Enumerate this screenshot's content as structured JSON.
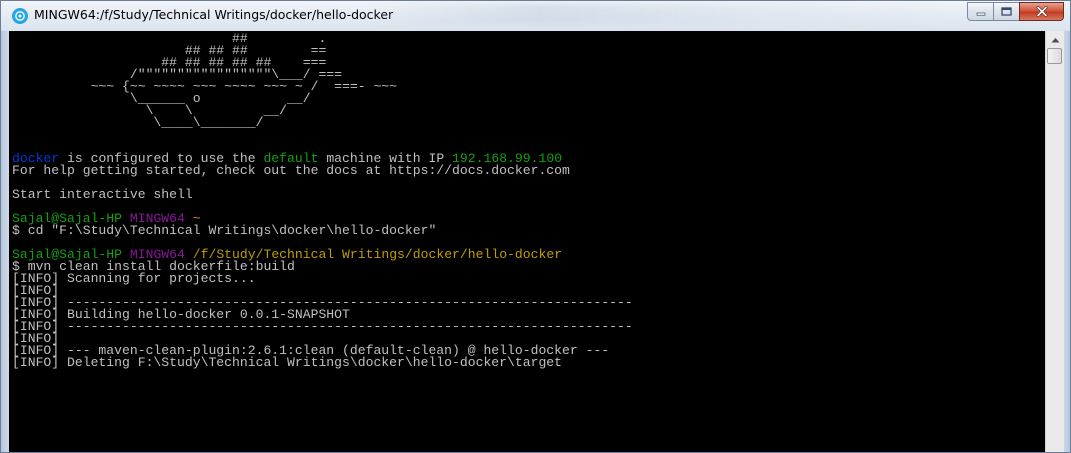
{
  "window": {
    "title": "MINGW64:/f/Study/Technical Writings/docker/hello-docker",
    "icon": "git-bash-icon",
    "controls": {
      "minimize_icon": "minimize-icon",
      "maximize_icon": "maximize-icon",
      "close_icon": "close-icon"
    }
  },
  "colors": {
    "background": "#000000",
    "text": "#c0c0c0",
    "blue": "#0037da",
    "green": "#13a10e",
    "magenta": "#881798",
    "yellow": "#c19c00"
  },
  "terminal": {
    "lines": [
      {
        "segments": [
          {
            "text": "                            ##         .",
            "color": "white"
          }
        ]
      },
      {
        "segments": [
          {
            "text": "                      ## ## ##        ==",
            "color": "white"
          }
        ]
      },
      {
        "segments": [
          {
            "text": "                   ## ## ## ## ##    ===",
            "color": "white"
          }
        ]
      },
      {
        "segments": [
          {
            "text": "               /\"\"\"\"\"\"\"\"\"\"\"\"\"\"\"\"\"\\___/ ===",
            "color": "white"
          }
        ]
      },
      {
        "segments": [
          {
            "text": "          ~~~ {~~ ~~~~ ~~~ ~~~~ ~~~ ~ /  ===- ~~~",
            "color": "white"
          }
        ]
      },
      {
        "segments": [
          {
            "text": "               \\______ o           __/",
            "color": "white"
          }
        ]
      },
      {
        "segments": [
          {
            "text": "                 \\    \\         __/",
            "color": "white"
          }
        ]
      },
      {
        "segments": [
          {
            "text": "                  \\____\\_______/",
            "color": "white"
          }
        ]
      },
      {
        "segments": [
          {
            "text": "",
            "color": "white"
          }
        ]
      },
      {
        "segments": [
          {
            "text": "",
            "color": "white"
          }
        ]
      },
      {
        "segments": [
          {
            "text": "docker",
            "color": "blue"
          },
          {
            "text": " is configured to use the ",
            "color": "white"
          },
          {
            "text": "default",
            "color": "green"
          },
          {
            "text": " machine with IP ",
            "color": "white"
          },
          {
            "text": "192.168.99.100",
            "color": "green"
          }
        ]
      },
      {
        "segments": [
          {
            "text": "For help getting started, check out the docs at https://docs.docker.com",
            "color": "white"
          }
        ]
      },
      {
        "segments": [
          {
            "text": "",
            "color": "white"
          }
        ]
      },
      {
        "segments": [
          {
            "text": "Start interactive shell",
            "color": "white"
          }
        ]
      },
      {
        "segments": [
          {
            "text": "",
            "color": "white"
          }
        ]
      },
      {
        "segments": [
          {
            "text": "Sajal@Sajal-HP",
            "color": "green"
          },
          {
            "text": " ",
            "color": "white"
          },
          {
            "text": "MINGW64",
            "color": "magenta"
          },
          {
            "text": " ",
            "color": "white"
          },
          {
            "text": "~",
            "color": "yellow"
          }
        ]
      },
      {
        "segments": [
          {
            "text": "$ cd \"F:\\Study\\Technical Writings\\docker\\hello-docker\"",
            "color": "white"
          }
        ]
      },
      {
        "segments": [
          {
            "text": "",
            "color": "white"
          }
        ]
      },
      {
        "segments": [
          {
            "text": "Sajal@Sajal-HP",
            "color": "green"
          },
          {
            "text": " ",
            "color": "white"
          },
          {
            "text": "MINGW64",
            "color": "magenta"
          },
          {
            "text": " ",
            "color": "white"
          },
          {
            "text": "/f/Study/Technical Writings/docker/hello-docker",
            "color": "yellow"
          }
        ]
      },
      {
        "segments": [
          {
            "text": "$ mvn clean install dockerfile:build",
            "color": "white"
          }
        ]
      },
      {
        "segments": [
          {
            "text": "[INFO] Scanning for projects...",
            "color": "white"
          }
        ]
      },
      {
        "segments": [
          {
            "text": "[INFO]",
            "color": "white"
          }
        ]
      },
      {
        "segments": [
          {
            "text": "[INFO] ------------------------------------------------------------------------",
            "color": "white"
          }
        ]
      },
      {
        "segments": [
          {
            "text": "[INFO] Building hello-docker 0.0.1-SNAPSHOT",
            "color": "white"
          }
        ]
      },
      {
        "segments": [
          {
            "text": "[INFO] ------------------------------------------------------------------------",
            "color": "white"
          }
        ]
      },
      {
        "segments": [
          {
            "text": "[INFO]",
            "color": "white"
          }
        ]
      },
      {
        "segments": [
          {
            "text": "[INFO] --- maven-clean-plugin:2.6.1:clean (default-clean) @ hello-docker ---",
            "color": "white"
          }
        ]
      },
      {
        "segments": [
          {
            "text": "[INFO] Deleting F:\\Study\\Technical Writings\\docker\\hello-docker\\target",
            "color": "white"
          }
        ]
      }
    ]
  },
  "scrollbar": {
    "up_icon": "scroll-up-arrow-icon",
    "position": 0
  }
}
